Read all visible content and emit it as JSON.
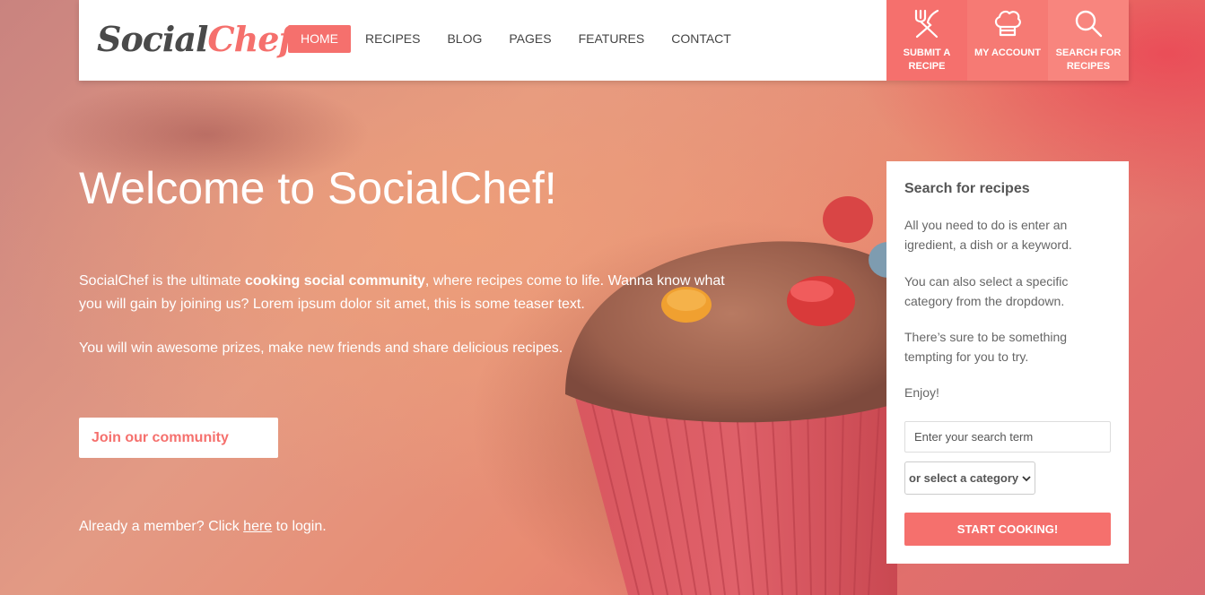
{
  "header": {
    "logo": {
      "part1": "Social",
      "part2": "Chef"
    },
    "nav": [
      {
        "label": "HOME",
        "active": true
      },
      {
        "label": "RECIPES"
      },
      {
        "label": "BLOG"
      },
      {
        "label": "PAGES"
      },
      {
        "label": "FEATURES"
      },
      {
        "label": "CONTACT"
      }
    ],
    "actions": [
      {
        "label": "SUBMIT A RECIPE",
        "icon": "fork-knife-icon"
      },
      {
        "label": "MY ACCOUNT",
        "icon": "chef-hat-icon"
      },
      {
        "label": "SEARCH FOR RECIPES",
        "icon": "search-icon"
      }
    ]
  },
  "hero": {
    "title": "Welcome to SocialChef!",
    "intro_before": "SocialChef is the ultimate ",
    "intro_bold": "cooking social community",
    "intro_after": ", where recipes come to life. Wanna know what you will gain by joining us? Lorem ipsum dolor sit amet, this is some teaser text.",
    "second_paragraph": "You will win awesome prizes, make new friends and share delicious recipes.",
    "join_button": "Join our community",
    "member_before": "Already a member? Click ",
    "member_link": "here",
    "member_after": " to login."
  },
  "search_panel": {
    "title": "Search for recipes",
    "p1": "All you need to do is enter an igredient, a dish or a keyword.",
    "p2": "You can also select a specific category from the dropdown.",
    "p3": "There’s sure to be something tempting for you to try.",
    "p4": "Enjoy!",
    "input_placeholder": "Enter your search term",
    "select_value": "or select a category",
    "button": "START COOKING!"
  },
  "colors": {
    "accent": "#f5706d",
    "panel_bg": "#ffffff",
    "text_dark": "#555555"
  }
}
